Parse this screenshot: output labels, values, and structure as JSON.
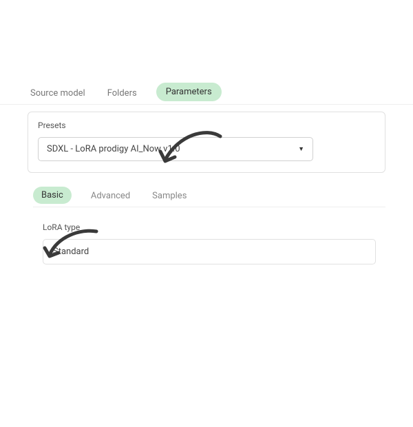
{
  "topTabs": {
    "sourceModel": "Source model",
    "folders": "Folders",
    "parameters": "Parameters"
  },
  "presets": {
    "label": "Presets",
    "value": "SDXL - LoRA prodigy AI_Now v1.0"
  },
  "subTabs": {
    "basic": "Basic",
    "advanced": "Advanced",
    "samples": "Samples"
  },
  "loraType": {
    "label": "LoRA type",
    "value": "Standard"
  }
}
